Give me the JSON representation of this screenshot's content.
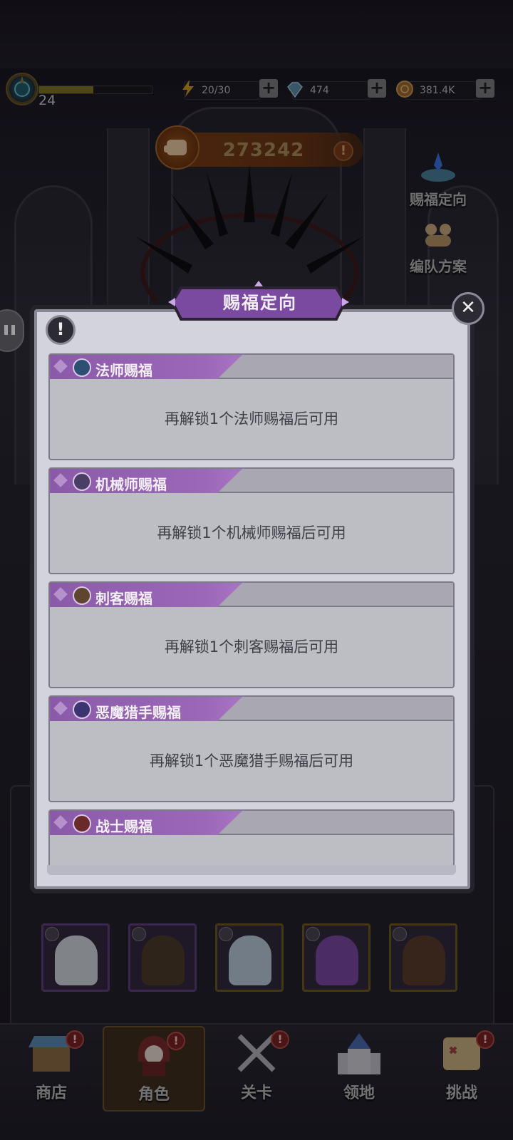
{
  "topbar": {
    "level": "24",
    "xp_fraction": 0.48,
    "energy": "20/30",
    "gems": "474",
    "gold": "381.4K"
  },
  "power": {
    "value": "273242"
  },
  "side_buttons": [
    {
      "label": "赐福定向",
      "icon": "blue-crystal-altar-icon"
    },
    {
      "label": "编队方案",
      "icon": "team-figures-icon"
    }
  ],
  "modal": {
    "title": "赐福定向",
    "close_symbol": "✕",
    "info_symbol": "!",
    "cards": [
      {
        "title": "法师赐福",
        "status": "再解锁1个法师赐福后可用",
        "icon": "mage-staff-icon",
        "icon_color": "#4a8fc8"
      },
      {
        "title": "机械师赐福",
        "status": "再解锁1个机械师赐福后可用",
        "icon": "gear-icon",
        "icon_color": "#8e7fb0"
      },
      {
        "title": "刺客赐福",
        "status": "再解锁1个刺客赐福后可用",
        "icon": "assassin-swirl-icon",
        "icon_color": "#c9a070"
      },
      {
        "title": "恶魔猎手赐福",
        "status": "再解锁1个恶魔猎手赐福后可用",
        "icon": "demon-hunter-icon",
        "icon_color": "#7a6ad0"
      },
      {
        "title": "战士赐福",
        "status": "",
        "icon": "warrior-sword-icon",
        "icon_color": "#c05050"
      }
    ]
  },
  "bottom_nav": [
    {
      "label": "商店",
      "icon": "shop-stall-icon",
      "badge": "!"
    },
    {
      "label": "角色",
      "icon": "hooded-character-icon",
      "badge": "!",
      "active": true
    },
    {
      "label": "关卡",
      "icon": "crossed-swords-icon",
      "badge": "!"
    },
    {
      "label": "领地",
      "icon": "castle-icon",
      "badge": ""
    },
    {
      "label": "挑战",
      "icon": "scroll-map-icon",
      "badge": "!"
    }
  ],
  "colors": {
    "modal_bg": "#d3d3de",
    "card_tab_purple": "#9b68b8",
    "power_orange": "#7a3e18",
    "alert_red": "#7a2222"
  }
}
